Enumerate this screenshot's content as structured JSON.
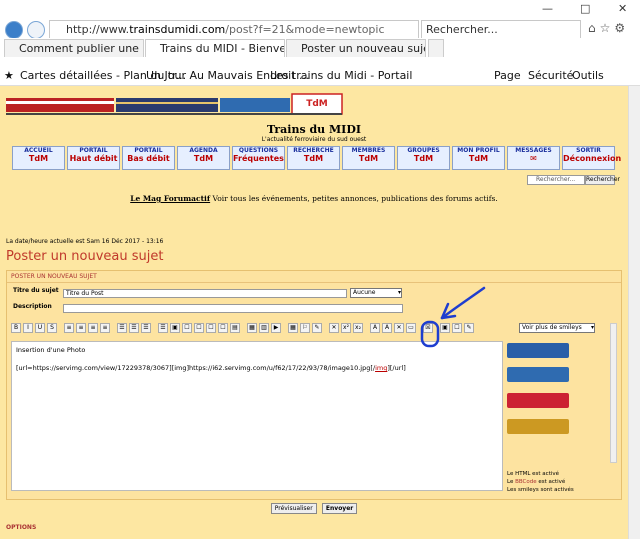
{
  "browser": {
    "title_controls": [
      "—",
      "□",
      "✕"
    ],
    "url_domain": "trainsdumidi.com",
    "url_prefix": "http://www.",
    "url_path": "/post?f=21&mode=newtopic",
    "search_placeholder": "Rechercher...",
    "tabs": [
      {
        "label": "Comment publier une photo ..."
      },
      {
        "label": "Trains du MIDI - Bienvenue sur v..."
      },
      {
        "label": "Poster un nouveau sujet"
      }
    ],
    "favorites": [
      {
        "label": "Cartes détaillées - Plan du tr..."
      },
      {
        "label": "Un Jour Au Mauvais Endroit ..."
      },
      {
        "label": "Les trains du Midi - Portail"
      }
    ],
    "menus": [
      "Page",
      "Sécurité",
      "Outils"
    ]
  },
  "site": {
    "title": "Trains du MIDI",
    "subtitle": "L'actualité ferroviaire du sud ouest",
    "nav": [
      {
        "top": "ACCUEIL",
        "bottom": "TdM"
      },
      {
        "top": "PORTAIL",
        "bottom": "Haut débit"
      },
      {
        "top": "PORTAIL",
        "bottom": "Bas débit"
      },
      {
        "top": "AGENDA",
        "bottom": "TdM"
      },
      {
        "top": "QUESTIONS",
        "bottom": "Fréquentes"
      },
      {
        "top": "RECHERCHE",
        "bottom": "TdM"
      },
      {
        "top": "MEMBRES",
        "bottom": "TdM"
      },
      {
        "top": "GROUPES",
        "bottom": "TdM"
      },
      {
        "top": "MON PROFIL",
        "bottom": "TdM"
      },
      {
        "top": "MESSAGES",
        "bottom": "✉"
      },
      {
        "top": "SORTIR",
        "bottom": "Déconnexion"
      }
    ],
    "search_placeholder": "Rechercher...",
    "search_button": "Rechercher",
    "mag_link": "Le Mag Forumactif",
    "mag_text": " Voir tous les événements, petites annonces, publications des forums actifs.",
    "dateline": "La date/heure actuelle est Sam 16 Déc 2017 - 13:16",
    "page_title": "Poster un nouveau sujet"
  },
  "form": {
    "section_head": "POSTER UN NOUVEAU SUJET",
    "subject_label": "Titre du sujet",
    "subject_value": "Titre du Post",
    "subject_select": "Aucune",
    "description_label": "Description",
    "editor_line1": "Insertion d'une Photo",
    "editor_line2_a": "[url=https://servimg.com/view/17229378/3067][img]https://i62.servimg.com/u/f62/17/22/93/78/image10.jpg[/",
    "editor_line2_tag": "img",
    "editor_line2_b": "][/url]",
    "smiley_select": "Voir plus de smileys",
    "html_status": "Le HTML est activé",
    "bbcode_status_prefix": "Le ",
    "bbcode_link": "BBCode",
    "bbcode_status_suffix": " est activé",
    "smileys_status": "Les smileys sont activés",
    "preview_button": "Prévisualiser",
    "send_button": "Envoyer",
    "options_head": "OPTIONS"
  },
  "colors": {
    "page_bg": "#fde7a2",
    "accent_blue": "#1a2f9c",
    "title_red": "#c0392b",
    "annotation_blue": "#1f3ecf"
  }
}
